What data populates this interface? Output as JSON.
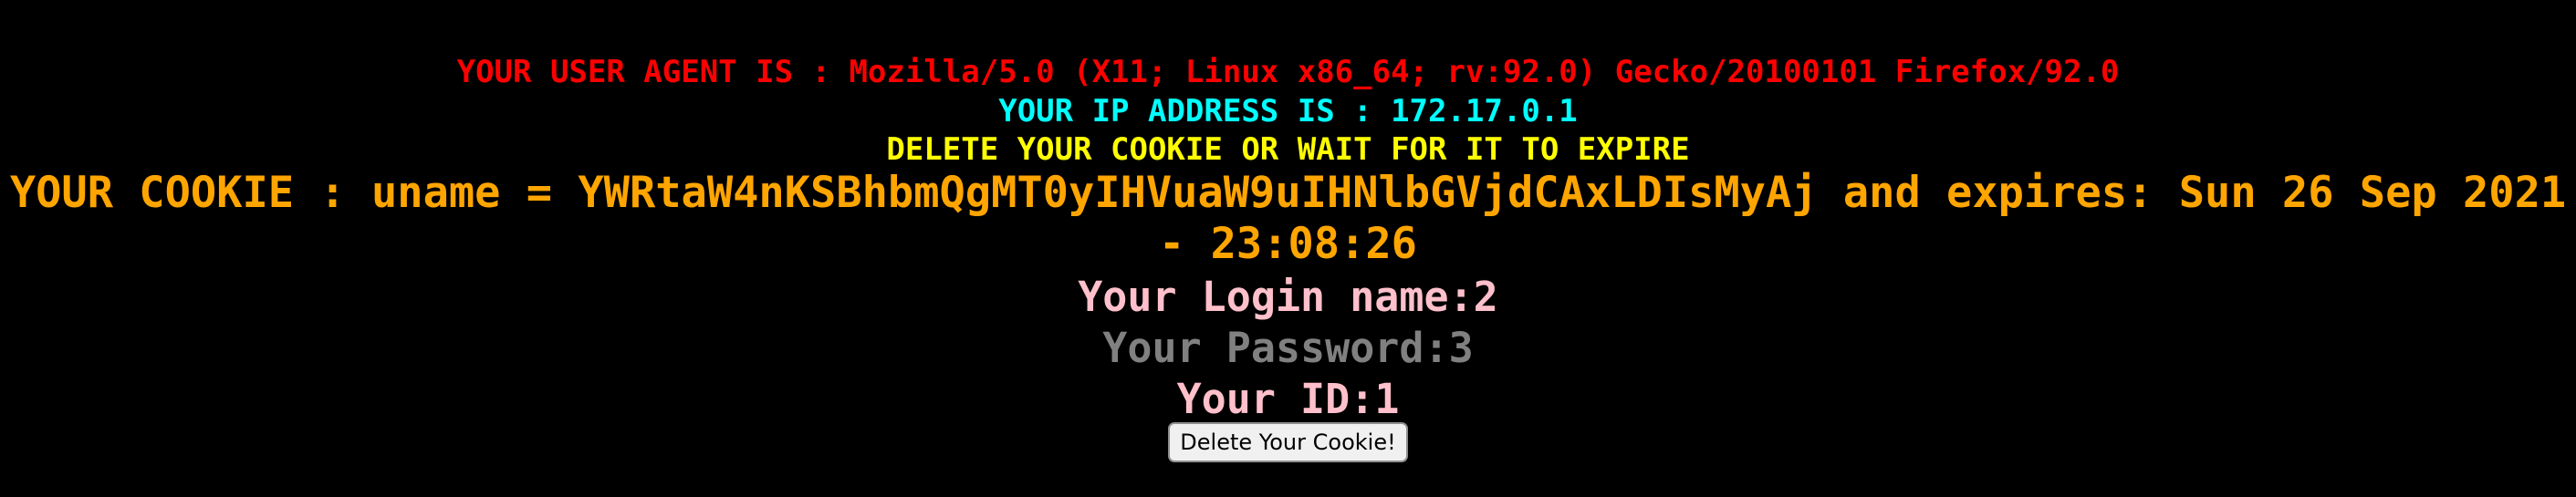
{
  "user_agent": {
    "label": "YOUR USER AGENT IS : Mozilla/5.0 (X11; Linux x86_64; rv:92.0) Gecko/20100101 Firefox/92.0"
  },
  "ip": {
    "label": "YOUR IP ADDRESS IS : 172.17.0.1"
  },
  "notice": {
    "text": "DELETE YOUR COOKIE OR WAIT FOR IT TO EXPIRE"
  },
  "cookie": {
    "line1": "YOUR COOKIE : uname = YWRtaW4nKSBhbmQgMT0yIHVuaW9uIHNlbGVjdCAxLDIsMyAj and expires: Sun 26 Sep 2021",
    "line2": "- 23:08:26"
  },
  "credentials": {
    "login": "Your Login name:2",
    "password": "Your Password:3",
    "id": "Your ID:1"
  },
  "button": {
    "label": "Delete Your Cookie!"
  },
  "colors": {
    "background": "#000000",
    "user_agent": "#ff0000",
    "ip": "#00ffff",
    "notice": "#ffff00",
    "cookie": "#ffa500",
    "login": "#ffc0cb",
    "password": "#808080",
    "id": "#ffc0cb"
  }
}
